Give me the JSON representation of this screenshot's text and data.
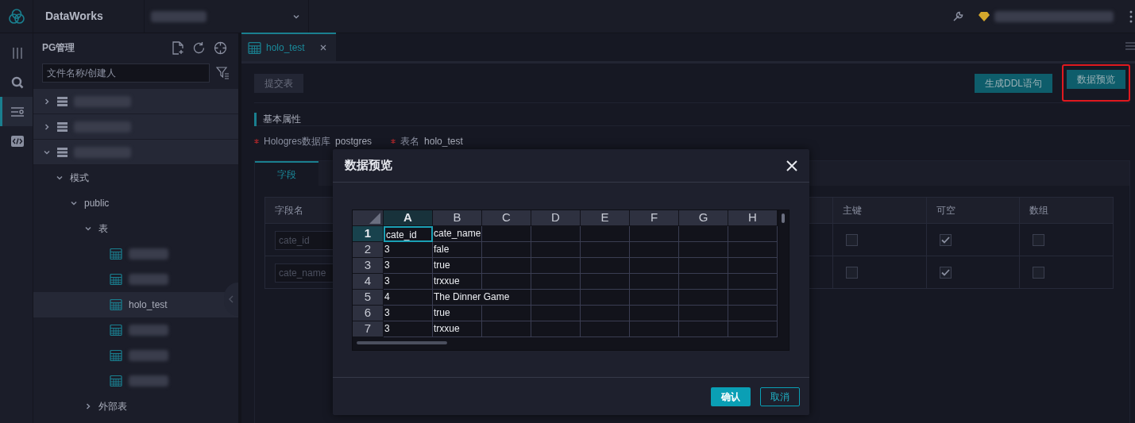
{
  "header": {
    "app_name": "DataWorks"
  },
  "rail": [
    {
      "kind": "columns",
      "selected": false
    },
    {
      "kind": "search",
      "selected": false
    },
    {
      "kind": "list",
      "selected": true
    },
    {
      "kind": "code",
      "selected": false
    }
  ],
  "sidebar": {
    "title": "PG管理",
    "search": {
      "placeholder": "文件名称/创建人"
    },
    "tree": [
      {
        "kind": "database",
        "expanded": false
      },
      {
        "kind": "database",
        "expanded": false
      },
      {
        "kind": "database",
        "expanded": true,
        "children": [
          {
            "kind": "folder",
            "label": "模式",
            "expanded": true,
            "children": [
              {
                "kind": "folder",
                "label": "public",
                "expanded": true,
                "children": [
                  {
                    "kind": "folder",
                    "label": "表",
                    "expanded": true,
                    "children": [
                      {
                        "kind": "table",
                        "selected": false
                      },
                      {
                        "kind": "table",
                        "selected": false
                      },
                      {
                        "kind": "table",
                        "label": "holo_test",
                        "selected": true
                      },
                      {
                        "kind": "table",
                        "selected": false
                      },
                      {
                        "kind": "table",
                        "selected": false
                      },
                      {
                        "kind": "table",
                        "selected": false
                      }
                    ]
                  },
                  {
                    "kind": "folder",
                    "label": "外部表",
                    "expanded": false
                  }
                ]
              }
            ]
          }
        ]
      }
    ]
  },
  "tabs": [
    {
      "label": "holo_test",
      "selected": true
    }
  ],
  "toolbar": {
    "submit": {
      "label": "提交表",
      "disabled": true
    },
    "actions": [
      {
        "label": "生成DDL语句",
        "highlighted": false
      },
      {
        "label": "数据预览",
        "highlighted": true
      }
    ]
  },
  "section_title": "基本属性",
  "properties": [
    {
      "label": "Hologres数据库",
      "value": "postgres",
      "required": true
    },
    {
      "label": "表名",
      "value": "holo_test",
      "required": true
    }
  ],
  "inner_tabs": [
    {
      "label": "字段",
      "selected": true
    }
  ],
  "fields_table": {
    "columns": [
      "字段名",
      "主键",
      "可空",
      "数组"
    ],
    "rows": [
      {
        "name": "cate_id",
        "primary_key": false,
        "nullable": true,
        "array": false
      },
      {
        "name": "cate_name",
        "primary_key": false,
        "nullable": true,
        "array": false
      }
    ]
  },
  "dialog": {
    "title": "数据预览",
    "sheet": {
      "columns": [
        {
          "label": "A",
          "selected": true
        },
        {
          "label": "B",
          "selected": false
        },
        {
          "label": "C",
          "selected": false
        },
        {
          "label": "D",
          "selected": false
        },
        {
          "label": "E",
          "selected": false
        },
        {
          "label": "F",
          "selected": false
        },
        {
          "label": "G",
          "selected": false
        },
        {
          "label": "H",
          "selected": false
        }
      ],
      "rows": [
        {
          "label": "1",
          "selected": true,
          "cells": [
            "cate_id",
            "cate_name"
          ]
        },
        {
          "label": "2",
          "selected": false,
          "cells": [
            "3",
            "fale"
          ]
        },
        {
          "label": "3",
          "selected": false,
          "cells": [
            "3",
            "true"
          ]
        },
        {
          "label": "4",
          "selected": false,
          "cells": [
            "3",
            "trxxue"
          ]
        },
        {
          "label": "5",
          "selected": false,
          "cells": [
            "4",
            "The Dinner Game"
          ]
        },
        {
          "label": "6",
          "selected": false,
          "cells": [
            "3",
            "true"
          ]
        },
        {
          "label": "7",
          "selected": false,
          "cells": [
            "3",
            "trxxue"
          ]
        }
      ]
    },
    "buttons": [
      {
        "label": "确认",
        "kind": "primary"
      },
      {
        "label": "取消",
        "kind": "secondary"
      }
    ]
  }
}
